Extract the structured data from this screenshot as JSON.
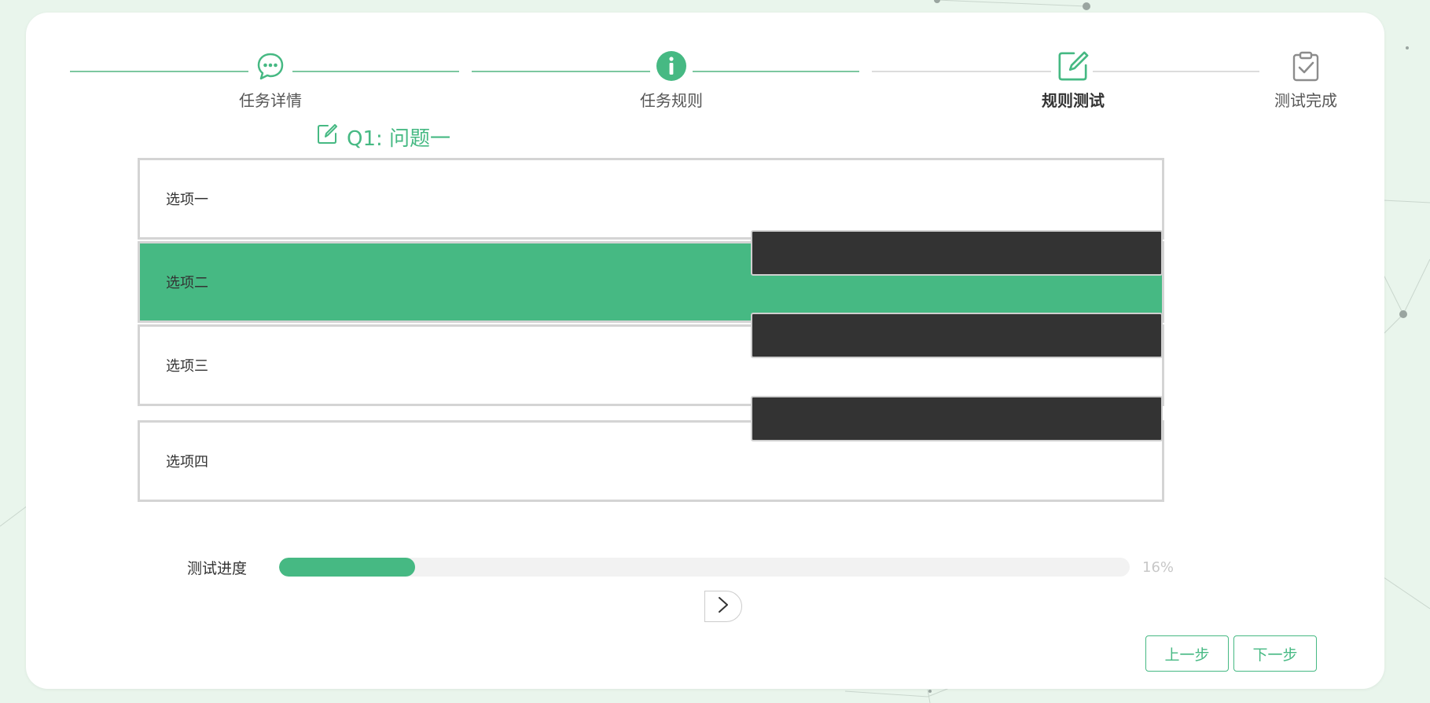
{
  "colors": {
    "accent": "#46b983",
    "line_done": "#7cc7a0",
    "line_todo": "#dcdcdc",
    "redaction": "#333333"
  },
  "steps": [
    {
      "label": "任务详情",
      "icon": "chat-bubble-icon",
      "state": "done"
    },
    {
      "label": "任务规则",
      "icon": "info-icon",
      "state": "done"
    },
    {
      "label": "规则测试",
      "icon": "edit-icon",
      "state": "active"
    },
    {
      "label": "测试完成",
      "icon": "clipboard-check-icon",
      "state": "todo"
    }
  ],
  "question": {
    "title": "Q1: 问题一",
    "icon": "edit-icon",
    "options": [
      {
        "label": "选项一",
        "selected": false
      },
      {
        "label": "选项二",
        "selected": true
      },
      {
        "label": "选项三",
        "selected": false
      },
      {
        "label": "选项四",
        "selected": false
      }
    ]
  },
  "progress": {
    "label": "测试进度",
    "value": 0.16,
    "text": "16%"
  },
  "next_question": {
    "icon": "chevron-right-icon"
  },
  "buttons": {
    "prev": "上一步",
    "next": "下一步"
  }
}
